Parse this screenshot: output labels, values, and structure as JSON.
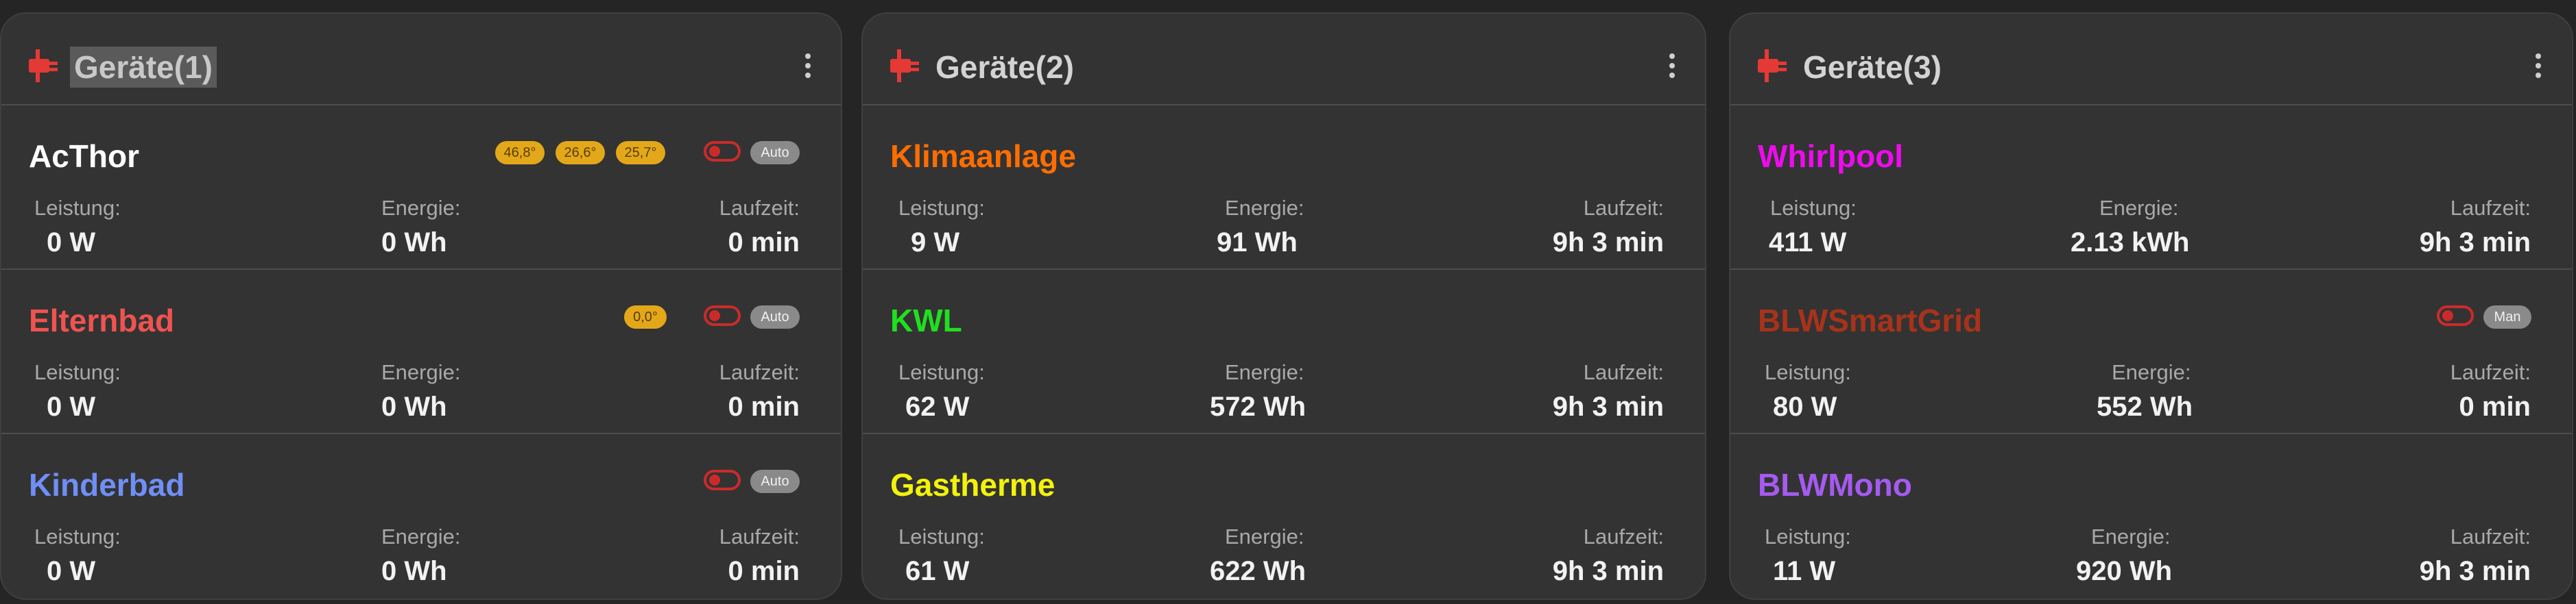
{
  "colors": {
    "accent_plug": "#e53935",
    "chip_temp": "#e3a81a",
    "toggle_off": "#cc2a2a"
  },
  "panels": [
    {
      "title": "Geräte(1)",
      "icon": "plug-icon",
      "devices": [
        {
          "name": "AcThor",
          "color": "#ffffff",
          "temps": [
            "46,8°",
            "26,6°",
            "25,7°"
          ],
          "toggle": "off",
          "mode": "Auto",
          "leistung_label": "Leistung:",
          "leistung": "0 W",
          "energie_label": "Energie:",
          "energie": "0 Wh",
          "laufzeit_label": "Laufzeit:",
          "laufzeit": "0 min"
        },
        {
          "name": "Elternbad",
          "color": "#ef5350",
          "temps": [
            "0,0°"
          ],
          "toggle": "off",
          "mode": "Auto",
          "leistung_label": "Leistung:",
          "leistung": "0 W",
          "energie_label": "Energie:",
          "energie": "0 Wh",
          "laufzeit_label": "Laufzeit:",
          "laufzeit": "0 min"
        },
        {
          "name": "Kinderbad",
          "color": "#6f8ff6",
          "temps": [],
          "toggle": "off",
          "mode": "Auto",
          "leistung_label": "Leistung:",
          "leistung": "0 W",
          "energie_label": "Energie:",
          "energie": "0 Wh",
          "laufzeit_label": "Laufzeit:",
          "laufzeit": "0 min"
        }
      ]
    },
    {
      "title": "Geräte(2)",
      "icon": "plug-icon",
      "devices": [
        {
          "name": "Klimaanlage",
          "color": "#ff6d00",
          "leistung_label": "Leistung:",
          "leistung": "9 W",
          "energie_label": "Energie:",
          "energie": "91 Wh",
          "laufzeit_label": "Laufzeit:",
          "laufzeit": "9h 3 min"
        },
        {
          "name": "KWL",
          "color": "#1fe01f",
          "leistung_label": "Leistung:",
          "leistung": "62 W",
          "energie_label": "Energie:",
          "energie": "572 Wh",
          "laufzeit_label": "Laufzeit:",
          "laufzeit": "9h 3 min"
        },
        {
          "name": "Gastherme",
          "color": "#f2f20d",
          "leistung_label": "Leistung:",
          "leistung": "61 W",
          "energie_label": "Energie:",
          "energie": "622 Wh",
          "laufzeit_label": "Laufzeit:",
          "laufzeit": "9h 3 min"
        }
      ]
    },
    {
      "title": "Geräte(3)",
      "icon": "plug-icon",
      "devices": [
        {
          "name": "Whirlpool",
          "color": "#ee0bee",
          "leistung_label": "Leistung:",
          "leistung": "411 W",
          "energie_label": "Energie:",
          "energie": "2.13 kWh",
          "laufzeit_label": "Laufzeit:",
          "laufzeit": "9h 3 min"
        },
        {
          "name": "BLWSmartGrid",
          "color": "#a8321a",
          "toggle": "off",
          "mode": "Man",
          "leistung_label": "Leistung:",
          "leistung": "80 W",
          "energie_label": "Energie:",
          "energie": "552 Wh",
          "laufzeit_label": "Laufzeit:",
          "laufzeit": "0 min"
        },
        {
          "name": "BLWMono",
          "color": "#a55af0",
          "leistung_label": "Leistung:",
          "leistung": "11 W",
          "energie_label": "Energie:",
          "energie": "920 Wh",
          "laufzeit_label": "Laufzeit:",
          "laufzeit": "9h 3 min"
        }
      ]
    }
  ]
}
